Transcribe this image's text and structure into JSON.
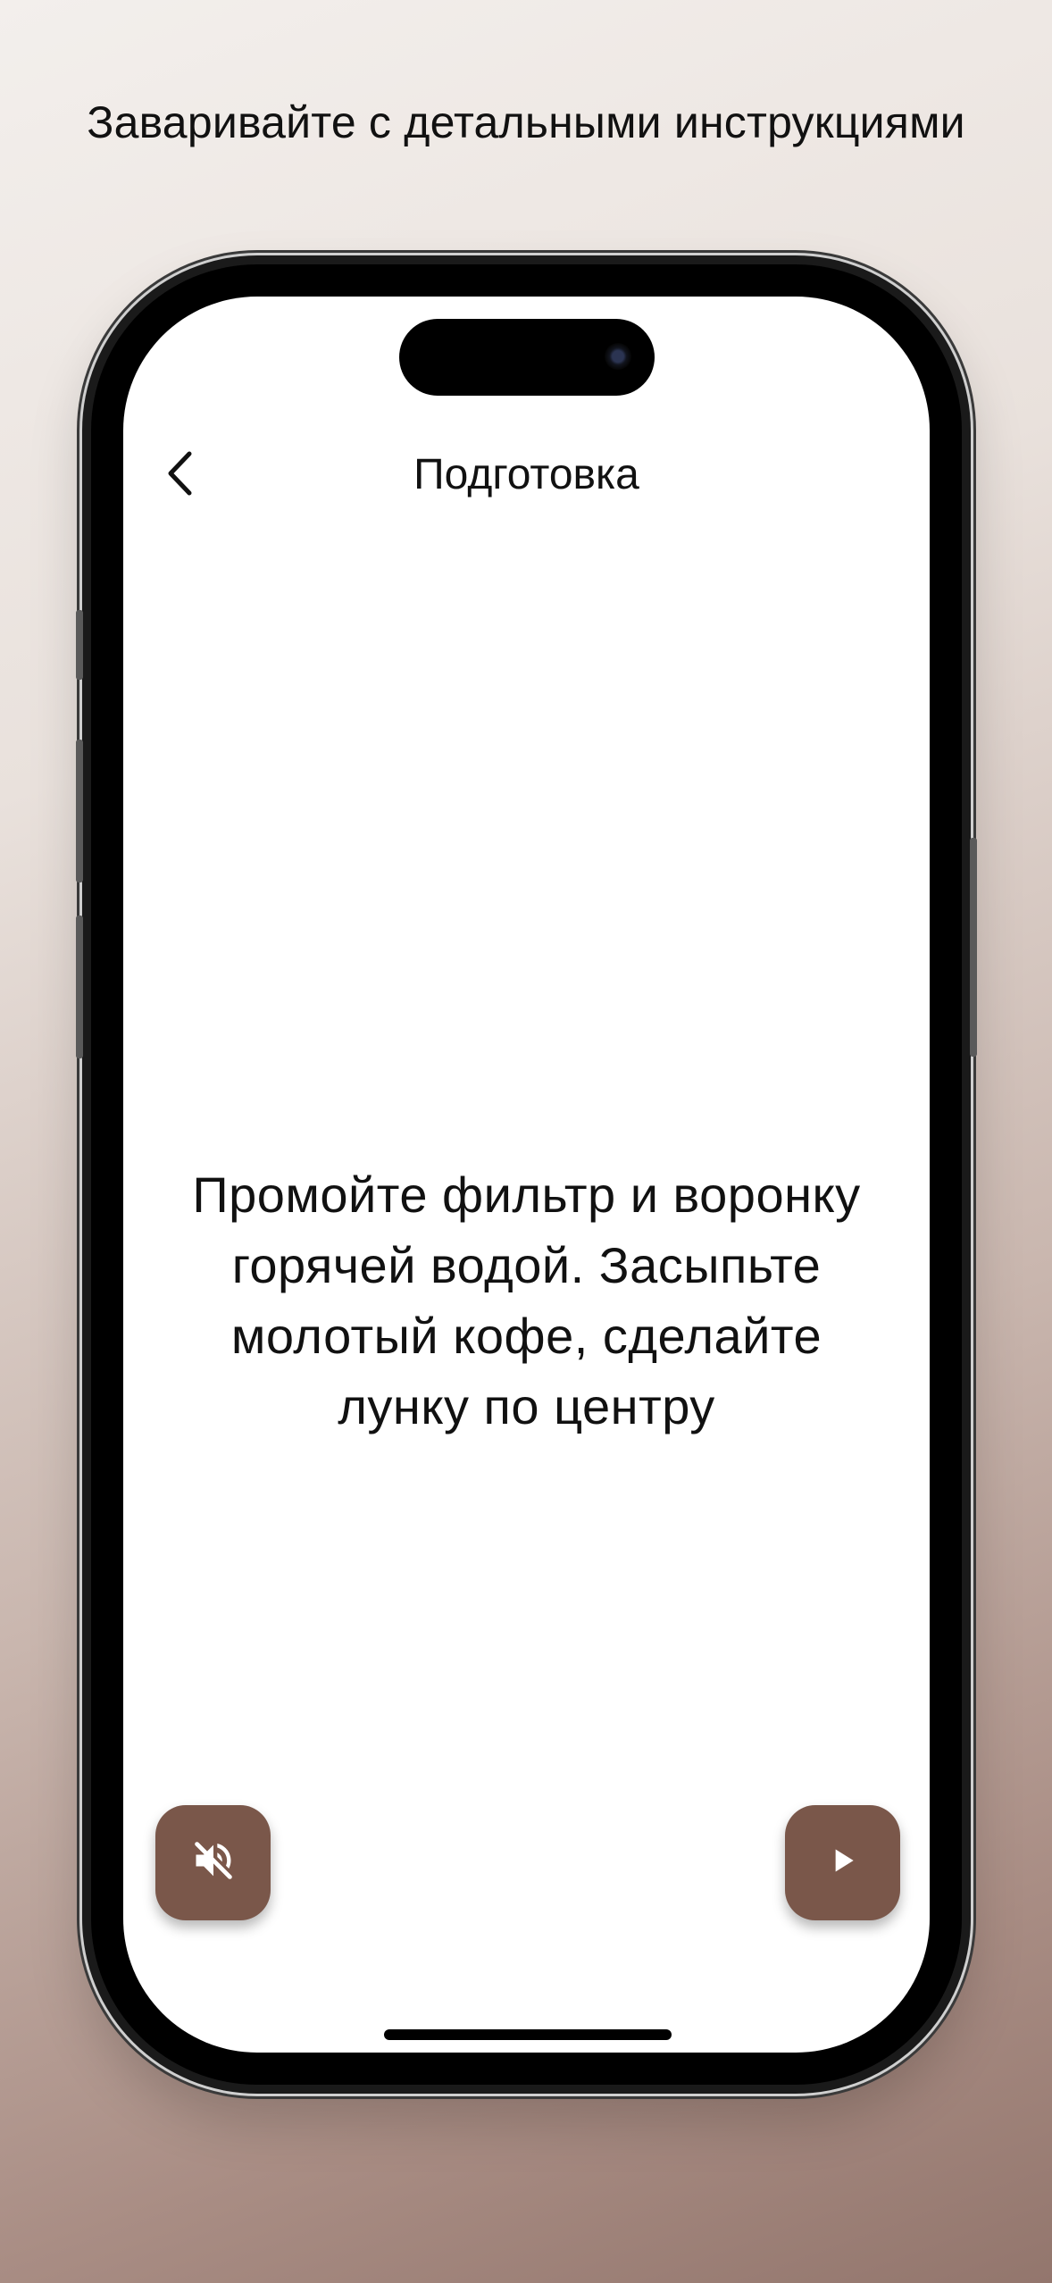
{
  "headline": "Заваривайте с детальными инструкциями",
  "screen": {
    "nav": {
      "back_icon": "chevron-left-icon",
      "title": "Подготовка"
    },
    "instruction": {
      "line1": "Промойте фильтр и воронку",
      "line2": "горячей водой. Засыпьте",
      "line3": "молотый кофе, сделайте",
      "line4": "лунку по центру"
    },
    "controls": {
      "mute_icon": "volume-off-icon",
      "play_icon": "play-icon"
    }
  },
  "colors": {
    "accent": "#7a574a",
    "text": "#111111",
    "screen_bg": "#ffffff"
  }
}
